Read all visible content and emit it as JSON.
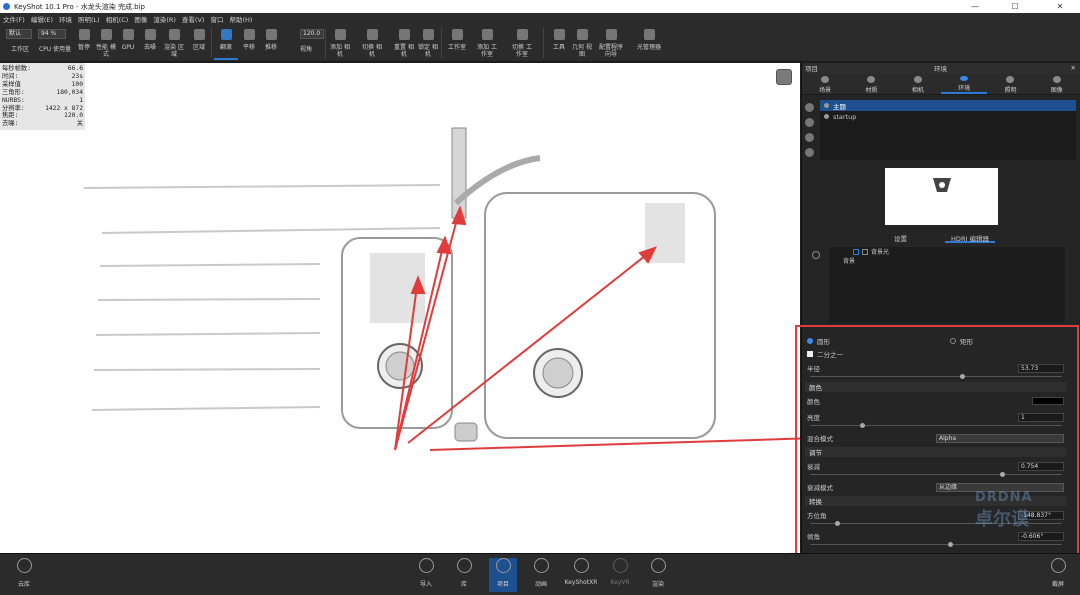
{
  "window": {
    "title": "KeyShot 10.1 Pro  - 水龙头渲染 完成.bip",
    "minimize": "—",
    "maximize": "☐",
    "close": "✕"
  },
  "menu": [
    "文件(F)",
    "编辑(E)",
    "环境",
    "照明(L)",
    "相机(C)",
    "图像",
    "渲染(R)",
    "查看(V)",
    "窗口",
    "帮助(H)"
  ],
  "toolbar": {
    "workspace_value": "默认",
    "cpu_value": "94 %",
    "fov_value": "120.0",
    "items": [
      {
        "label": "工作区"
      },
      {
        "label": "CPU 使用量"
      },
      {
        "label": "暂停"
      },
      {
        "label": "性能 模式"
      },
      {
        "label": "GPU"
      },
      {
        "label": "去噪"
      },
      {
        "label": "渲染 区域"
      },
      {
        "label": "区域"
      },
      {
        "label": "翻滚"
      },
      {
        "label": "平移"
      },
      {
        "label": "推移"
      },
      {
        "label": "视角"
      },
      {
        "label": "添加 相机"
      },
      {
        "label": "切换 相机"
      },
      {
        "label": "重置 相机"
      },
      {
        "label": "锁定 相机"
      },
      {
        "label": "工作室"
      },
      {
        "label": "添加 工作室"
      },
      {
        "label": "切换 工作室"
      },
      {
        "label": "工具"
      },
      {
        "label": "几何 视图"
      },
      {
        "label": "配置程序 向导"
      },
      {
        "label": "光管理器"
      }
    ]
  },
  "stats": [
    {
      "k": "每秒帧数:",
      "v": "66.6"
    },
    {
      "k": "时间:",
      "v": "23s"
    },
    {
      "k": "采样值",
      "v": "100"
    },
    {
      "k": "三角形:",
      "v": "180,034"
    },
    {
      "k": "NURBS:",
      "v": "1"
    },
    {
      "k": "分辨率:",
      "v": "1422 x 872"
    },
    {
      "k": "焦距:",
      "v": "120.0"
    },
    {
      "k": "去噪:",
      "v": "关"
    }
  ],
  "panel": {
    "left_label": "项目",
    "title": "环境",
    "tabs": [
      "场景",
      "材质",
      "相机",
      "环境",
      "照明",
      "图像"
    ],
    "env_list": [
      {
        "name": "主题"
      },
      {
        "name": "startup"
      }
    ],
    "sub_tabs": [
      "设置",
      "HDRI 编辑器"
    ],
    "hdr_rows": [
      "背景光"
    ],
    "hdr_label": "背景",
    "shape_circle": "圆形",
    "shape_rect": "矩形",
    "half_label": "二分之一",
    "radius_label": "半径",
    "radius_value": "53.73",
    "color_section": "颜色",
    "color_label": "颜色",
    "brightness_label": "亮度",
    "brightness_value": "1",
    "blend_label": "混合模式",
    "blend_value": "Alpha",
    "adjust_section": "调节",
    "falloff_label": "衰减",
    "falloff_value": "0.754",
    "falloff_mode_label": "衰减模式",
    "falloff_mode_value": "从边缘",
    "transform_section": "转换",
    "azimuth_label": "方位角",
    "azimuth_value": "-148.837°",
    "elevation_label": "倾角",
    "elevation_value": "-0.606°"
  },
  "bottombar": {
    "cloud": "云库",
    "items": [
      "导入",
      "库",
      "项目",
      "动画",
      "KeyShotXR",
      "KeyVR",
      "渲染"
    ],
    "screenshot": "截屏"
  },
  "watermark": {
    "line1": "DRDNA",
    "line2": "卓尔谟"
  },
  "accent_color": "#2c7ad6",
  "annotation_color": "#e03c3c"
}
